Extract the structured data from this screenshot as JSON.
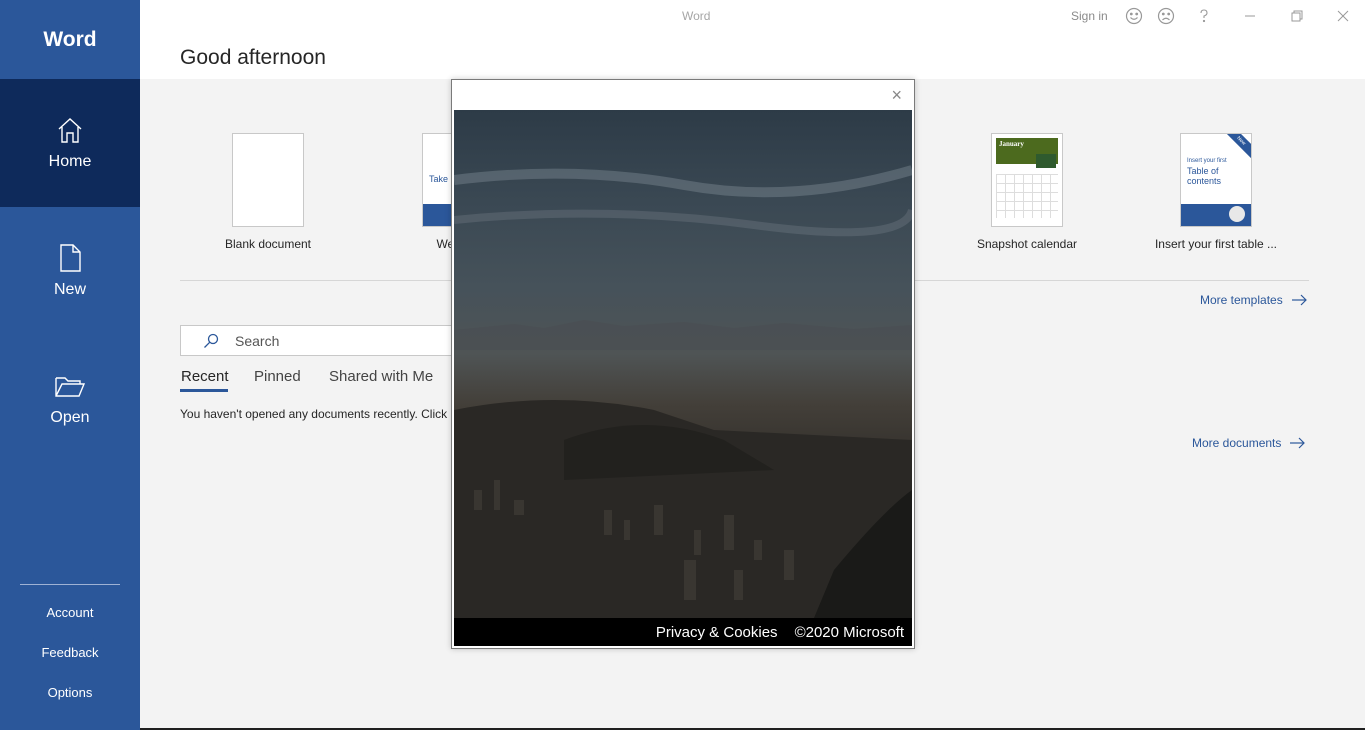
{
  "window": {
    "title": "Word",
    "sign_in": "Sign in"
  },
  "sidebar": {
    "app_name": "Word",
    "nav": [
      {
        "label": "Home",
        "icon": "home-icon",
        "active": true
      },
      {
        "label": "New",
        "icon": "new-document-icon"
      },
      {
        "label": "Open",
        "icon": "folder-open-icon"
      }
    ],
    "links": [
      "Account",
      "Feedback",
      "Options"
    ]
  },
  "main": {
    "greeting": "Good afternoon",
    "templates": [
      {
        "label": "Blank document"
      },
      {
        "label": "Welcom",
        "thumb_text": "Take"
      },
      {
        "label": "Snapshot calendar",
        "thumb_title": "January",
        "thumb_sub": "TUAN"
      },
      {
        "label": "Insert your first table ...",
        "thumb_line1": "Insert your first",
        "thumb_line2": "Table of",
        "thumb_line3": "contents",
        "thumb_badge": "New"
      }
    ],
    "more_templates": "More templates",
    "search_placeholder": "Search",
    "tabs": [
      "Recent",
      "Pinned",
      "Shared with Me"
    ],
    "empty_message": "You haven't opened any documents recently. Click",
    "more_documents": "More documents"
  },
  "modal": {
    "close_glyph": "×",
    "footer_privacy": "Privacy & Cookies",
    "footer_copyright": "©2020 Microsoft"
  },
  "colors": {
    "brand": "#2b579a",
    "sidebar_active": "#0e2a5b",
    "link": "#2b579a"
  }
}
